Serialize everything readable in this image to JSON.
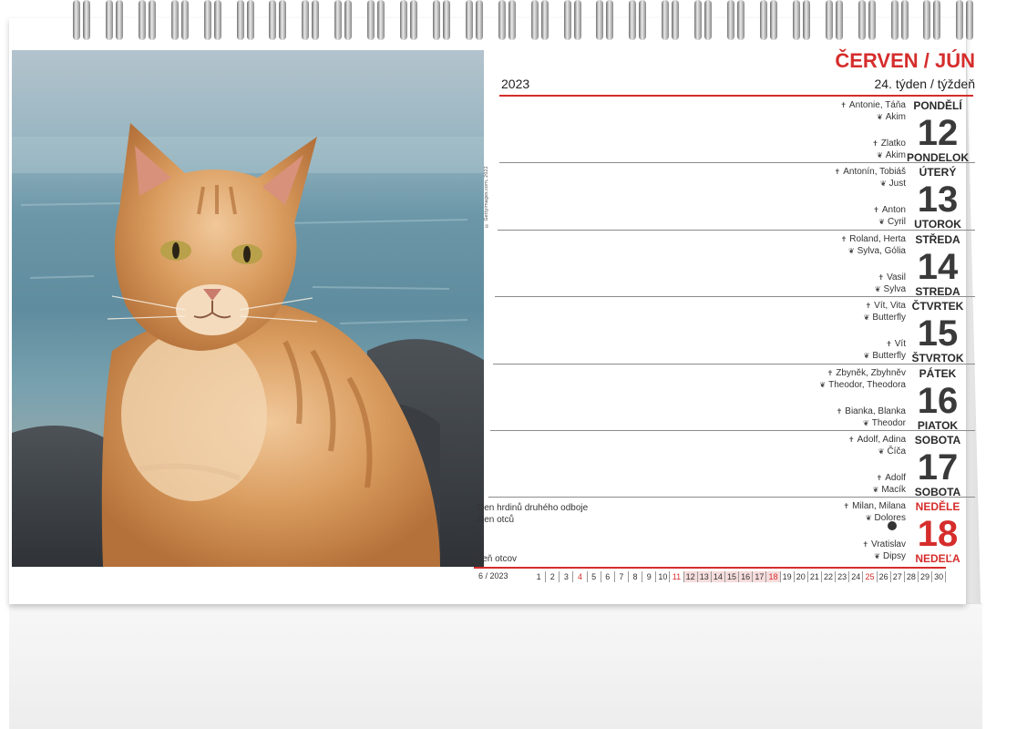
{
  "header": {
    "month": "ČERVEN / JÚN",
    "year": "2023",
    "week": "24. týden / týždeň"
  },
  "photo": {
    "credit": "© Gettyimages.com, 2022",
    "subject": ""
  },
  "icons": {
    "name_marker_cz": "cross-icon",
    "name_marker_sk": "leaf-icon",
    "moon_phase": "full-moon-icon"
  },
  "colors": {
    "accent": "#d52d2c",
    "text": "#3a3a3a"
  },
  "days": [
    {
      "top": "PONDĚLÍ",
      "num": "12",
      "bottom": "PONDELOK",
      "cz1": "Antonie, Táňa",
      "sk1": "Akim",
      "cz2": "Zlatko",
      "sk2": "Akim",
      "sunday": false
    },
    {
      "top": "ÚTERÝ",
      "num": "13",
      "bottom": "UTOROK",
      "cz1": "Antonín, Tobiáš",
      "sk1": "Just",
      "cz2": "Anton",
      "sk2": "Cyril",
      "sunday": false
    },
    {
      "top": "STŘEDA",
      "num": "14",
      "bottom": "STREDA",
      "cz1": "Roland, Herta",
      "sk1": "Sylva, Gólia",
      "cz2": "Vasil",
      "sk2": "Sylva",
      "sunday": false
    },
    {
      "top": "ČTVRTEK",
      "num": "15",
      "bottom": "ŠTVRTOK",
      "cz1": "Vít, Vita",
      "sk1": "Butterfly",
      "cz2": "Vít",
      "sk2": "Butterfly",
      "sunday": false
    },
    {
      "top": "PÁTEK",
      "num": "16",
      "bottom": "PIATOK",
      "cz1": "Zbyněk, Zbyhněv",
      "sk1": "Theodor, Theodora",
      "cz2": "Bianka, Blanka",
      "sk2": "Theodor",
      "sunday": false
    },
    {
      "top": "SOBOTA",
      "num": "17",
      "bottom": "SOBOTA",
      "cz1": "Adolf, Adina",
      "sk1": "Číča",
      "cz2": "Adolf",
      "sk2": "Macík",
      "sunday": false
    },
    {
      "top": "NEDĚLE",
      "num": "18",
      "bottom": "NEDEĽA",
      "cz1": "Milan, Milana",
      "sk1": "Dolores",
      "cz2": "Vratislav",
      "sk2": "Dipsy",
      "sunday": true
    }
  ],
  "holidays": {
    "cz_line1": "Den hrdinů druhého odboje",
    "cz_line2": "Den otců",
    "sk_line1": "Deň otcov"
  },
  "strip": {
    "label": "6 / 2023",
    "days": [
      "1",
      "2",
      "3",
      "4",
      "5",
      "6",
      "7",
      "8",
      "9",
      "10",
      "11",
      "12",
      "13",
      "14",
      "15",
      "16",
      "17",
      "18",
      "19",
      "20",
      "21",
      "22",
      "23",
      "24",
      "25",
      "26",
      "27",
      "28",
      "29",
      "30"
    ],
    "sundays": [
      "4",
      "11",
      "18",
      "25"
    ],
    "current_week": [
      "12",
      "13",
      "14",
      "15",
      "16",
      "17",
      "18"
    ]
  }
}
